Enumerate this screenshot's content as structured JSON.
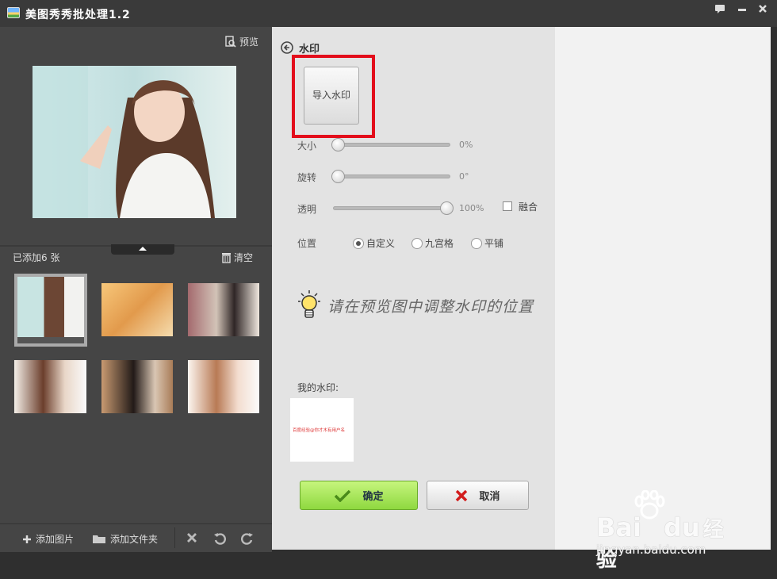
{
  "app": {
    "title": "美图秀秀批处理1.2"
  },
  "left": {
    "preview_label": "预览",
    "added_count": "已添加6 张",
    "clear_label": "清空",
    "toolbar": {
      "add_image": "添加图片",
      "add_folder": "添加文件夹"
    }
  },
  "watermark": {
    "section_title": "水印",
    "import_button": "导入水印",
    "size": {
      "label": "大小",
      "value": "0%",
      "fraction": 0
    },
    "rotate": {
      "label": "旋转",
      "value": "0°",
      "fraction": 0
    },
    "opacity": {
      "label": "透明",
      "value": "100%",
      "fraction": 1
    },
    "blend_label": "融合",
    "position": {
      "label": "位置",
      "options": [
        "自定义",
        "九宫格",
        "平铺"
      ],
      "selected": "自定义"
    },
    "hint": "请在预览图中调整水印的位置",
    "my_watermark_label": "我的水印:",
    "my_watermark_text": "百度经验@你才木有用户名",
    "ok_button": "确定",
    "cancel_button": "取消"
  },
  "site_mark": {
    "logo_bai": "Bai",
    "logo_du": "du",
    "logo_cn": "经验",
    "url": "jingyan.baidu.com"
  }
}
